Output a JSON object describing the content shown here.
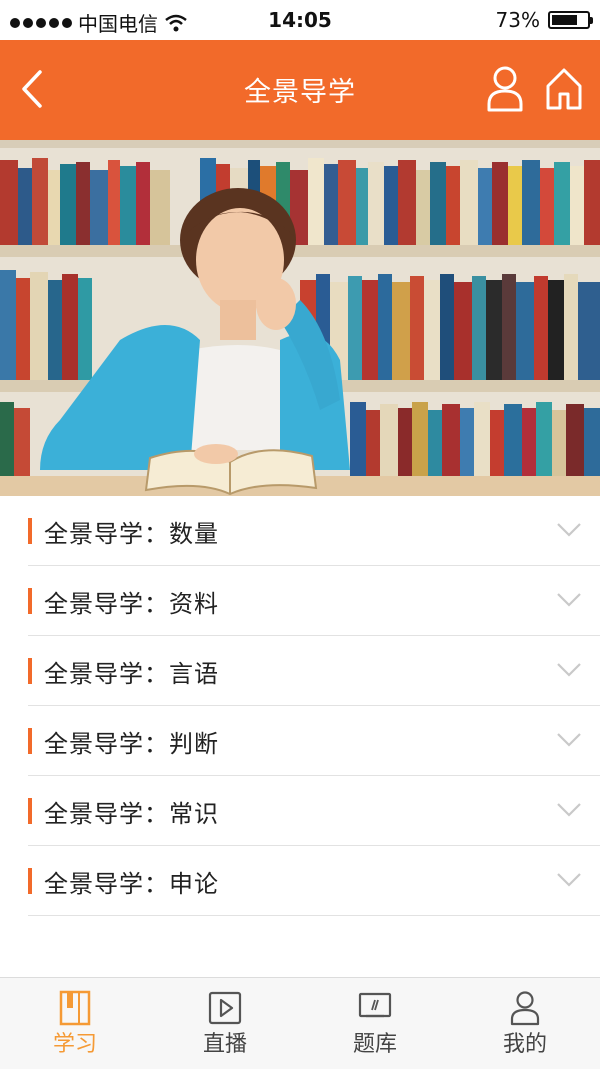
{
  "status_bar": {
    "carrier": "中国电信",
    "time": "14:05",
    "battery": "73%",
    "battery_level": 0.73
  },
  "nav": {
    "title": "全景导学",
    "back_icon": "chevron-left-icon",
    "user_icon": "user-icon",
    "home_icon": "home-icon"
  },
  "hero": {
    "description_icon": "student-reading-photo"
  },
  "list": {
    "items": [
      {
        "label": "全景导学：数量"
      },
      {
        "label": "全景导学：资料"
      },
      {
        "label": "全景导学：言语"
      },
      {
        "label": "全景导学：判断"
      },
      {
        "label": "全景导学：常识"
      },
      {
        "label": "全景导学：申论"
      }
    ]
  },
  "tabbar": {
    "tabs": [
      {
        "label": "学习",
        "icon": "book-icon",
        "active": true
      },
      {
        "label": "直播",
        "icon": "play-icon",
        "active": false
      },
      {
        "label": "题库",
        "icon": "monitor-icon",
        "active": false
      },
      {
        "label": "我的",
        "icon": "user-icon",
        "active": false
      }
    ]
  },
  "colors": {
    "accent": "#f26a2a",
    "tab_active": "#f59a35"
  }
}
